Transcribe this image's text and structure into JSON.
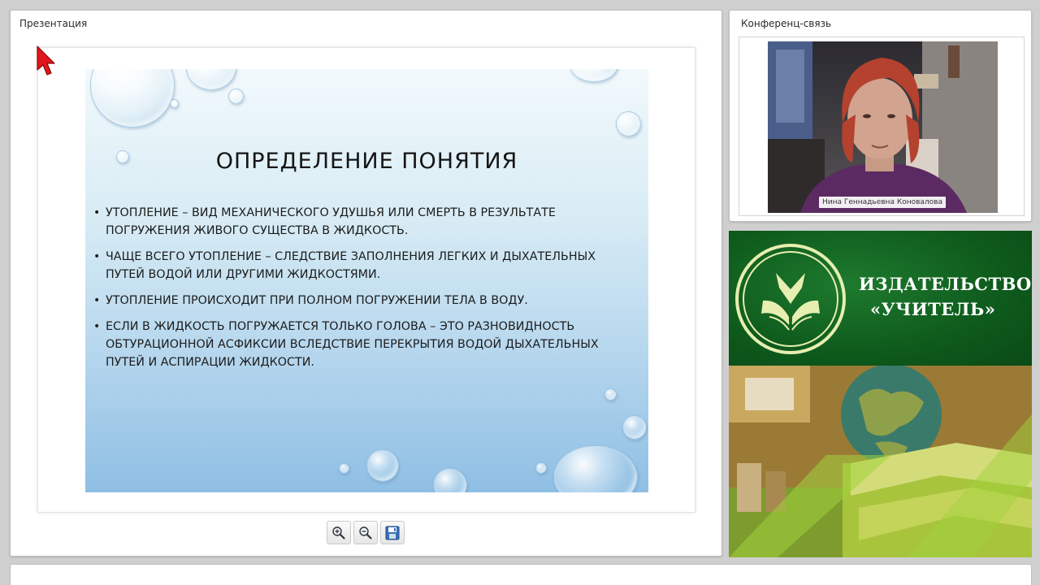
{
  "presentation": {
    "title": "Презентация",
    "slide": {
      "heading": "ОПРЕДЕЛЕНИЕ ПОНЯТИЯ",
      "bullet_char": "•",
      "bullets": [
        {
          "line1": "УТОПЛЕНИЕ – ВИД МЕХАНИЧЕСКОГО УДУШЬЯ ИЛИ СМЕРТЬ В РЕЗУЛЬТАТЕ",
          "line2": "ПОГРУЖЕНИЯ ЖИВОГО СУЩЕСТВА В ЖИДКОСТЬ.",
          "line3": ""
        },
        {
          "line1": "ЧАЩЕ ВСЕГО УТОПЛЕНИЕ – СЛЕДСТВИЕ ЗАПОЛНЕНИЯ ЛЕГКИХ И ДЫХАТЕЛЬНЫХ",
          "line2": "ПУТЕЙ ВОДОЙ ИЛИ ДРУГИМИ ЖИДКОСТЯМИ.",
          "line3": ""
        },
        {
          "line1": "УТОПЛЕНИЕ ПРОИСХОДИТ ПРИ ПОЛНОМ ПОГРУЖЕНИИ ТЕЛА В ВОДУ.",
          "line2": "",
          "line3": ""
        },
        {
          "line1": "ЕСЛИ В ЖИДКОСТЬ ПОГРУЖАЕТСЯ ТОЛЬКО ГОЛОВА – ЭТО РАЗНОВИДНОСТЬ",
          "line2": "ОБТУРАЦИОННОЙ АСФИКСИИ ВСЛЕДСТВИЕ ПЕРЕКРЫТИЯ ВОДОЙ ДЫХАТЕЛЬНЫХ",
          "line3": "ПУТЕЙ И АСПИРАЦИИ ЖИДКОСТИ."
        }
      ]
    },
    "toolbar": {
      "buttons": [
        {
          "icon": "zoom-in-icon"
        },
        {
          "icon": "zoom-out-icon"
        },
        {
          "icon": "save-icon"
        }
      ]
    }
  },
  "conference": {
    "title": "Конференц-связь",
    "participant_name": "Нина Геннадьевна Коновалова"
  },
  "banner": {
    "line1": "ИЗДАТЕЛЬСТВО",
    "line2": "«УЧИТЕЛЬ»"
  },
  "colors": {
    "banner_green": "#0e5a1c",
    "cursor_red": "#e0161b"
  }
}
